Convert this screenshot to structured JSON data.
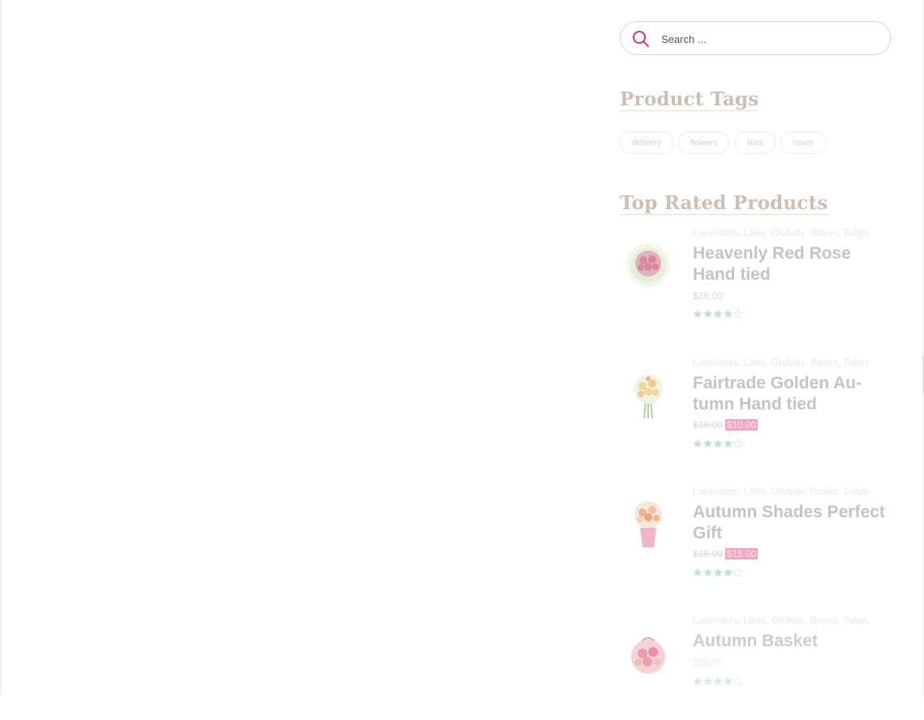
{
  "search": {
    "placeholder": "Search ...",
    "value": ""
  },
  "colors": {
    "accent": "#e21d6b",
    "heading": "#cdbfb3",
    "sale_badge": "#f0a6c3",
    "star": "#bfe3d6"
  },
  "product_tags": {
    "title": "Product Tags",
    "tags": [
      "delivery",
      "flowers",
      "lilies",
      "roses"
    ]
  },
  "top_rated": {
    "title": "Top Rated Products",
    "products": [
      {
        "categories": "Lavenders, Lilies, Orchids, Roses, Tulips",
        "name": "Heavenly Red Rose Hand tied",
        "price": "$36.00",
        "old_price": "",
        "sale_price": "",
        "rating": 4,
        "thumb_icon": "red-rose-bouquet-icon"
      },
      {
        "categories": "Lavenders, Lilies, Orchids, Roses, Tulips",
        "name": "Fairtrade Golden Au-tumn Hand tied",
        "price": "",
        "old_price": "$16.00",
        "sale_price": "$10.00",
        "rating": 4,
        "thumb_icon": "golden-bouquet-icon"
      },
      {
        "categories": "Lavenders, Lilies, Orchids, Roses, Tulips",
        "name": "Autumn Shades Perfect Gift",
        "price": "",
        "old_price": "$16.00",
        "sale_price": "$15.00",
        "rating": 4,
        "thumb_icon": "autumn-vase-icon"
      },
      {
        "categories": "Lavenders, Lilies, Orchids, Roses, Tulips",
        "name": "Autumn Basket",
        "price": "$20.00",
        "old_price": "",
        "sale_price": "",
        "rating": 4,
        "thumb_icon": "flower-basket-icon"
      }
    ]
  }
}
